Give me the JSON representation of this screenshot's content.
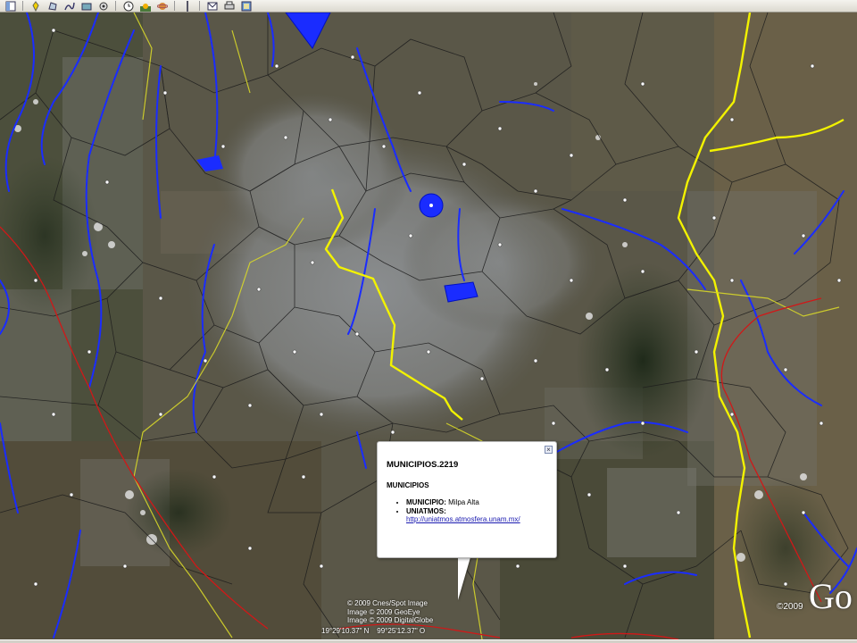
{
  "toolbar": {
    "icons": [
      "sidebar-icon",
      "placemark-icon",
      "polygon-icon",
      "path-icon",
      "overlay-icon",
      "tour-icon",
      "history-icon",
      "sun-icon",
      "planets-icon",
      "ruler-icon",
      "email-icon",
      "print-icon",
      "map-icon"
    ]
  },
  "balloon": {
    "title": "MUNICIPIOS.2219",
    "subtitle": "MUNICIPIOS",
    "municipio_key": "MUNICIPIO:",
    "municipio_value": "Milpa Alta",
    "uniatmos_key": "UNIATMOS:",
    "link": "http://uniatmos.atmosfera.unam.mx/",
    "close": "×"
  },
  "attribution": {
    "line1": "© 2009 Cnes/Spot Image",
    "line2": "Image © 2009 GeoEye",
    "line3": "Image © 2009 DigitalGlobe"
  },
  "coordinates": "19°29'10.37\" N    99°25'12.37\" O",
  "logo": {
    "year": "©2009",
    "brand": "Go"
  },
  "colors": {
    "rivers": "#1a2cff",
    "yellow_boundary": "#f2f200",
    "red_boundary": "#d01818",
    "municipal_lines": "#1c1c1c"
  }
}
